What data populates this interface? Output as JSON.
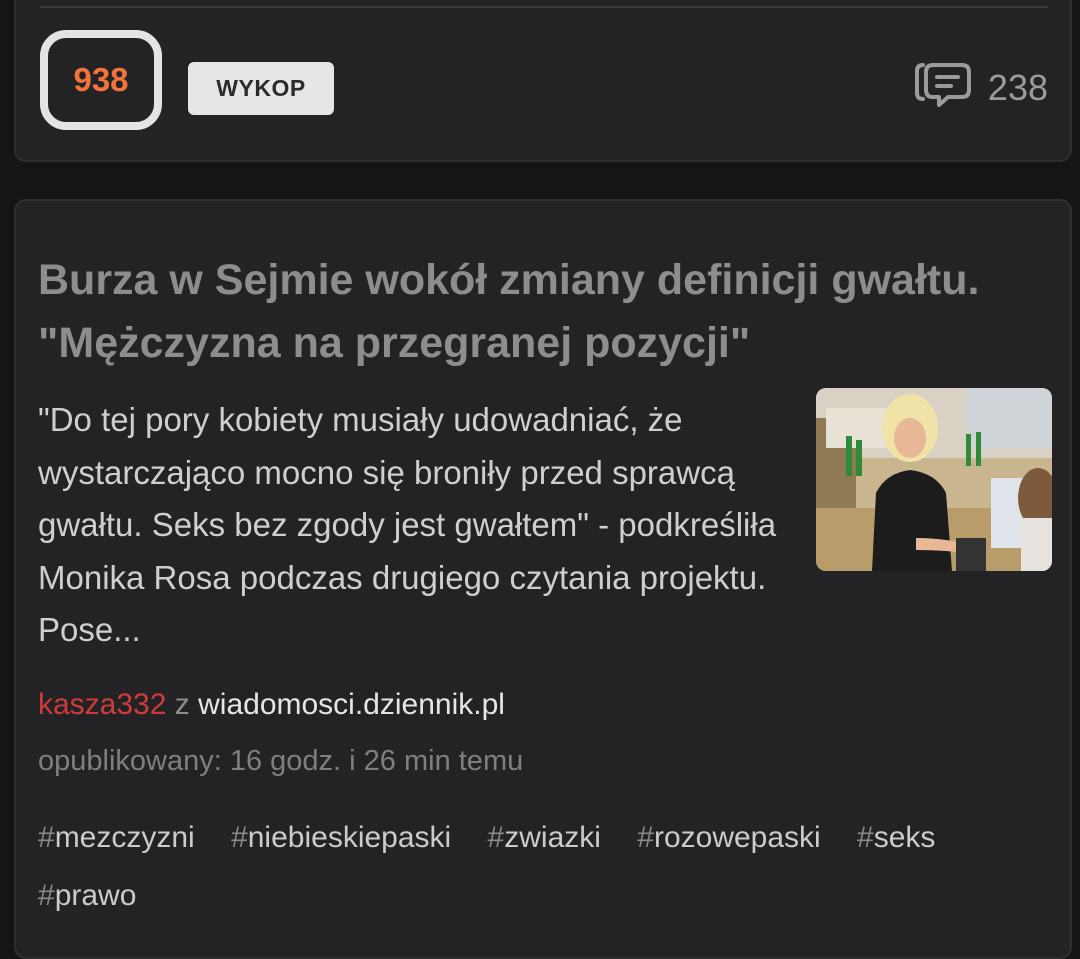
{
  "top_card": {
    "vote_count": "938",
    "wykop_label": "WYKOP",
    "comment_count": "238"
  },
  "article": {
    "title": "Burza w Sejmie wokół zmiany definicji gwałtu. \"Mężczyzna na przegranej pozycji\"",
    "excerpt": "\"Do tej pory kobiety musiały udowadniać, że wystarczająco mocno się broniły przed sprawcą gwałtu. Seks bez zgody jest gwałtem\" - podkreśliła Monika Rosa podczas drugiego czytania projektu. Pose...",
    "author": "kasza332",
    "source_prefix": "z",
    "domain": "wiadomosci.dziennik.pl",
    "published": "opublikowany: 16 godz. i 26 min temu",
    "tags": [
      "mezczyzni",
      "niebieskiepaski",
      "zwiazki",
      "rozowepaski",
      "seks",
      "prawo"
    ]
  },
  "icons": {
    "comments": "comment-bubble-icon"
  },
  "colors": {
    "vote_orange": "#f2733b",
    "author_red": "#d13a3a",
    "background": "#151517",
    "card": "#232325"
  }
}
